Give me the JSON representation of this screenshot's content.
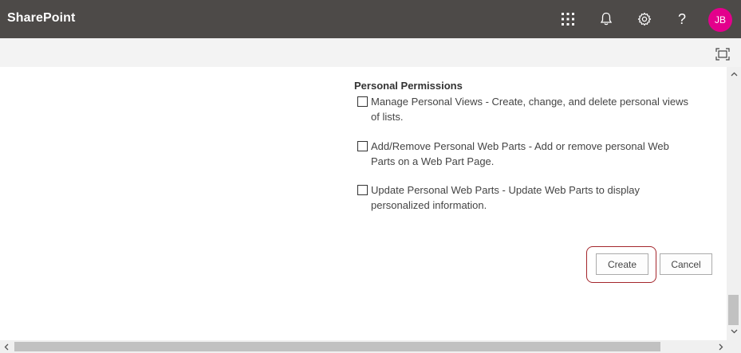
{
  "suitebar": {
    "title": "SharePoint",
    "icons": [
      "app-launcher-icon",
      "bell-icon",
      "gear-icon",
      "help-icon"
    ],
    "help_glyph": "?",
    "avatar_initials": "JB",
    "avatar_color": "#e3008c"
  },
  "permissions": {
    "heading": "Personal Permissions",
    "items": [
      {
        "name": "Manage Personal Views",
        "sep": " - ",
        "description": "Create, change, and delete personal views of lists.",
        "checked": false
      },
      {
        "name": "Add/Remove Personal Web Parts",
        "sep": " - ",
        "description": "Add or remove personal Web Parts on a Web Part Page.",
        "checked": false
      },
      {
        "name": "Update Personal Web Parts",
        "sep": " - ",
        "description": "Update Web Parts to display personalized information.",
        "checked": false
      }
    ]
  },
  "actions": {
    "create_label": "Create",
    "cancel_label": "Cancel"
  }
}
